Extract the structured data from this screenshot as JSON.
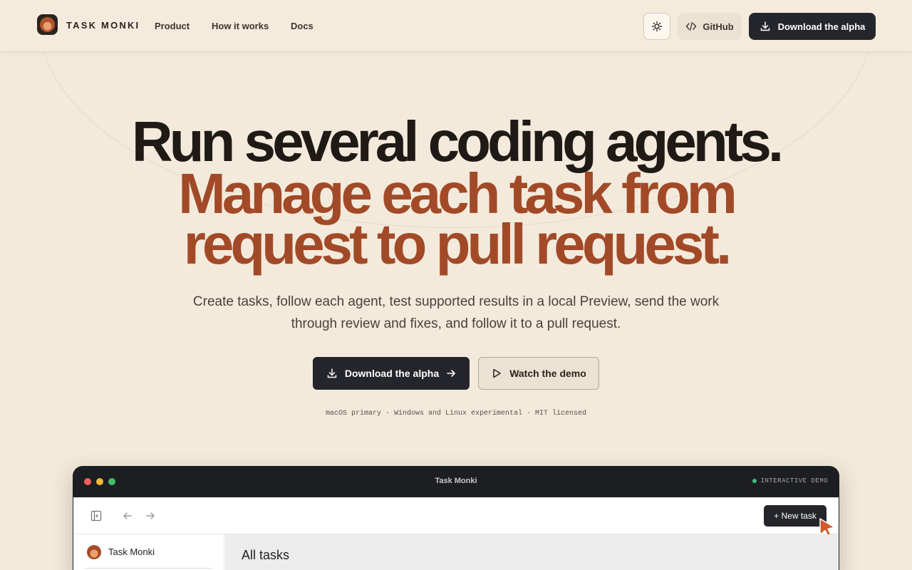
{
  "nav": {
    "brand": "TASK MONKI",
    "links": [
      "Product",
      "How it works",
      "Docs"
    ],
    "github_label": "GitHub",
    "download_label": "Download the alpha"
  },
  "hero": {
    "line1": "Run several coding agents.",
    "line2": "Manage each task from",
    "line3": "request to pull request.",
    "subtitle": "Create tasks, follow each agent, test supported results in a local Preview, send the work through review and fixes, and follow it to a pull request.",
    "cta_primary": "Download the alpha",
    "cta_secondary": "Watch the demo",
    "platform_note": "macOS primary · Windows and Linux experimental · MIT licensed"
  },
  "demo": {
    "window_title": "Task Monki",
    "badge": "INTERACTIVE DEMO",
    "new_task_label": "+ New task",
    "sidebar_workspace": "Task Monki",
    "main_title": "All tasks"
  },
  "colors": {
    "background": "#f3eadc",
    "accent": "#a24a28",
    "dark_button": "#24262b",
    "status_live": "#3fbf7f"
  }
}
